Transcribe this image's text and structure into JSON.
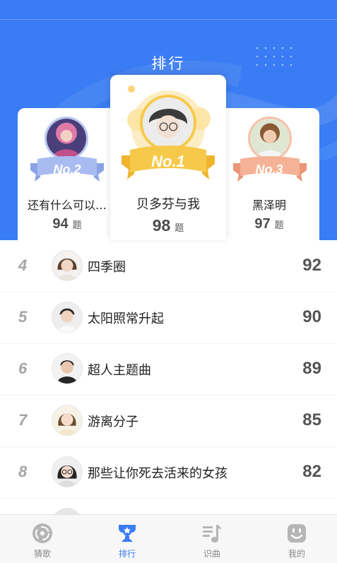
{
  "header": {
    "title": "排行"
  },
  "podium": [
    {
      "place_label": "No.2",
      "name": "还有什么可以…",
      "score": "94",
      "unit": "题"
    },
    {
      "place_label": "No.1",
      "name": "贝多芬与我",
      "score": "98",
      "unit": "题"
    },
    {
      "place_label": "No.3",
      "name": "黑泽明",
      "score": "97",
      "unit": "题"
    }
  ],
  "ranking": [
    {
      "rank": "4",
      "name": "四季圈",
      "score": "92"
    },
    {
      "rank": "5",
      "name": "太阳照常升起",
      "score": "90"
    },
    {
      "rank": "6",
      "name": "超人主题曲",
      "score": "89"
    },
    {
      "rank": "7",
      "name": "游离分子",
      "score": "85"
    },
    {
      "rank": "8",
      "name": "那些让你死去活来的女孩",
      "score": "82"
    }
  ],
  "tabs": [
    {
      "label": "猜歌",
      "icon": "disc-icon",
      "active": false
    },
    {
      "label": "排行",
      "icon": "trophy-icon",
      "active": true
    },
    {
      "label": "识曲",
      "icon": "music-list-icon",
      "active": false
    },
    {
      "label": "我的",
      "icon": "face-icon",
      "active": false
    }
  ],
  "colors": {
    "primary": "#3a7cf3",
    "gold": "#f7c94a",
    "silver": "#9fb4ee",
    "bronze": "#f3a98b"
  }
}
